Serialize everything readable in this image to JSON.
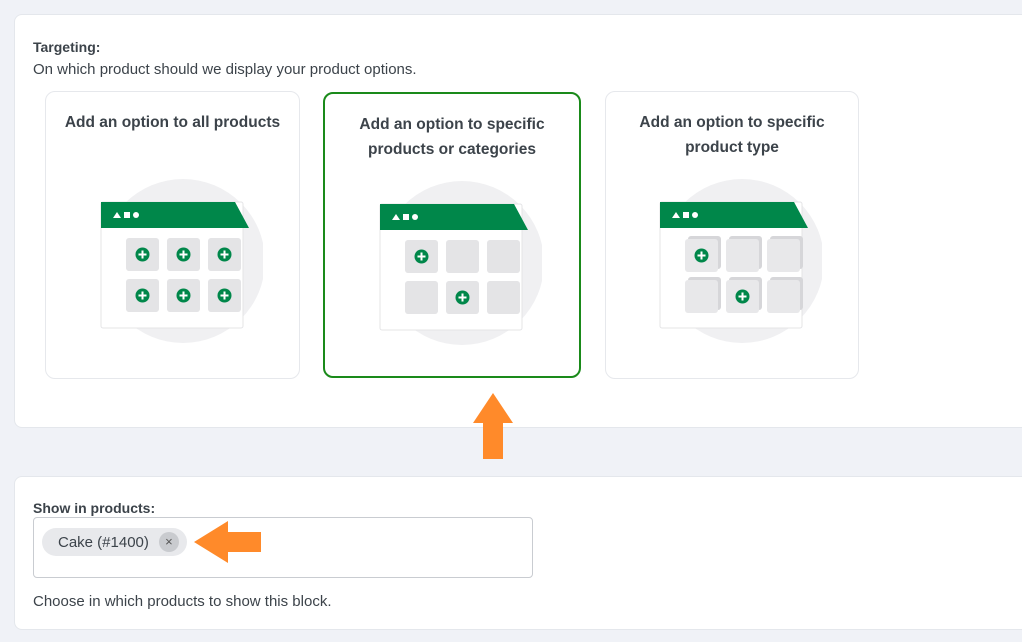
{
  "targeting": {
    "title": "Targeting:",
    "description": "On which product should we display your product options.",
    "options": [
      {
        "line1": "Add an option to all products",
        "line2": "",
        "selected": false
      },
      {
        "line1": "Add an option to specific",
        "line2": "products or categories",
        "selected": true
      },
      {
        "line1": "Add an option to specific",
        "line2": "product type",
        "selected": false
      }
    ]
  },
  "show_in_products": {
    "label": "Show in products:",
    "selected_items": [
      "Cake (#1400)"
    ],
    "remove_symbol": "×",
    "help": "Choose in which products to show this block."
  },
  "colors": {
    "accent_green": "#00874a",
    "selected_border": "#1a8a1a",
    "annotation_arrow": "#ff8a2a"
  }
}
